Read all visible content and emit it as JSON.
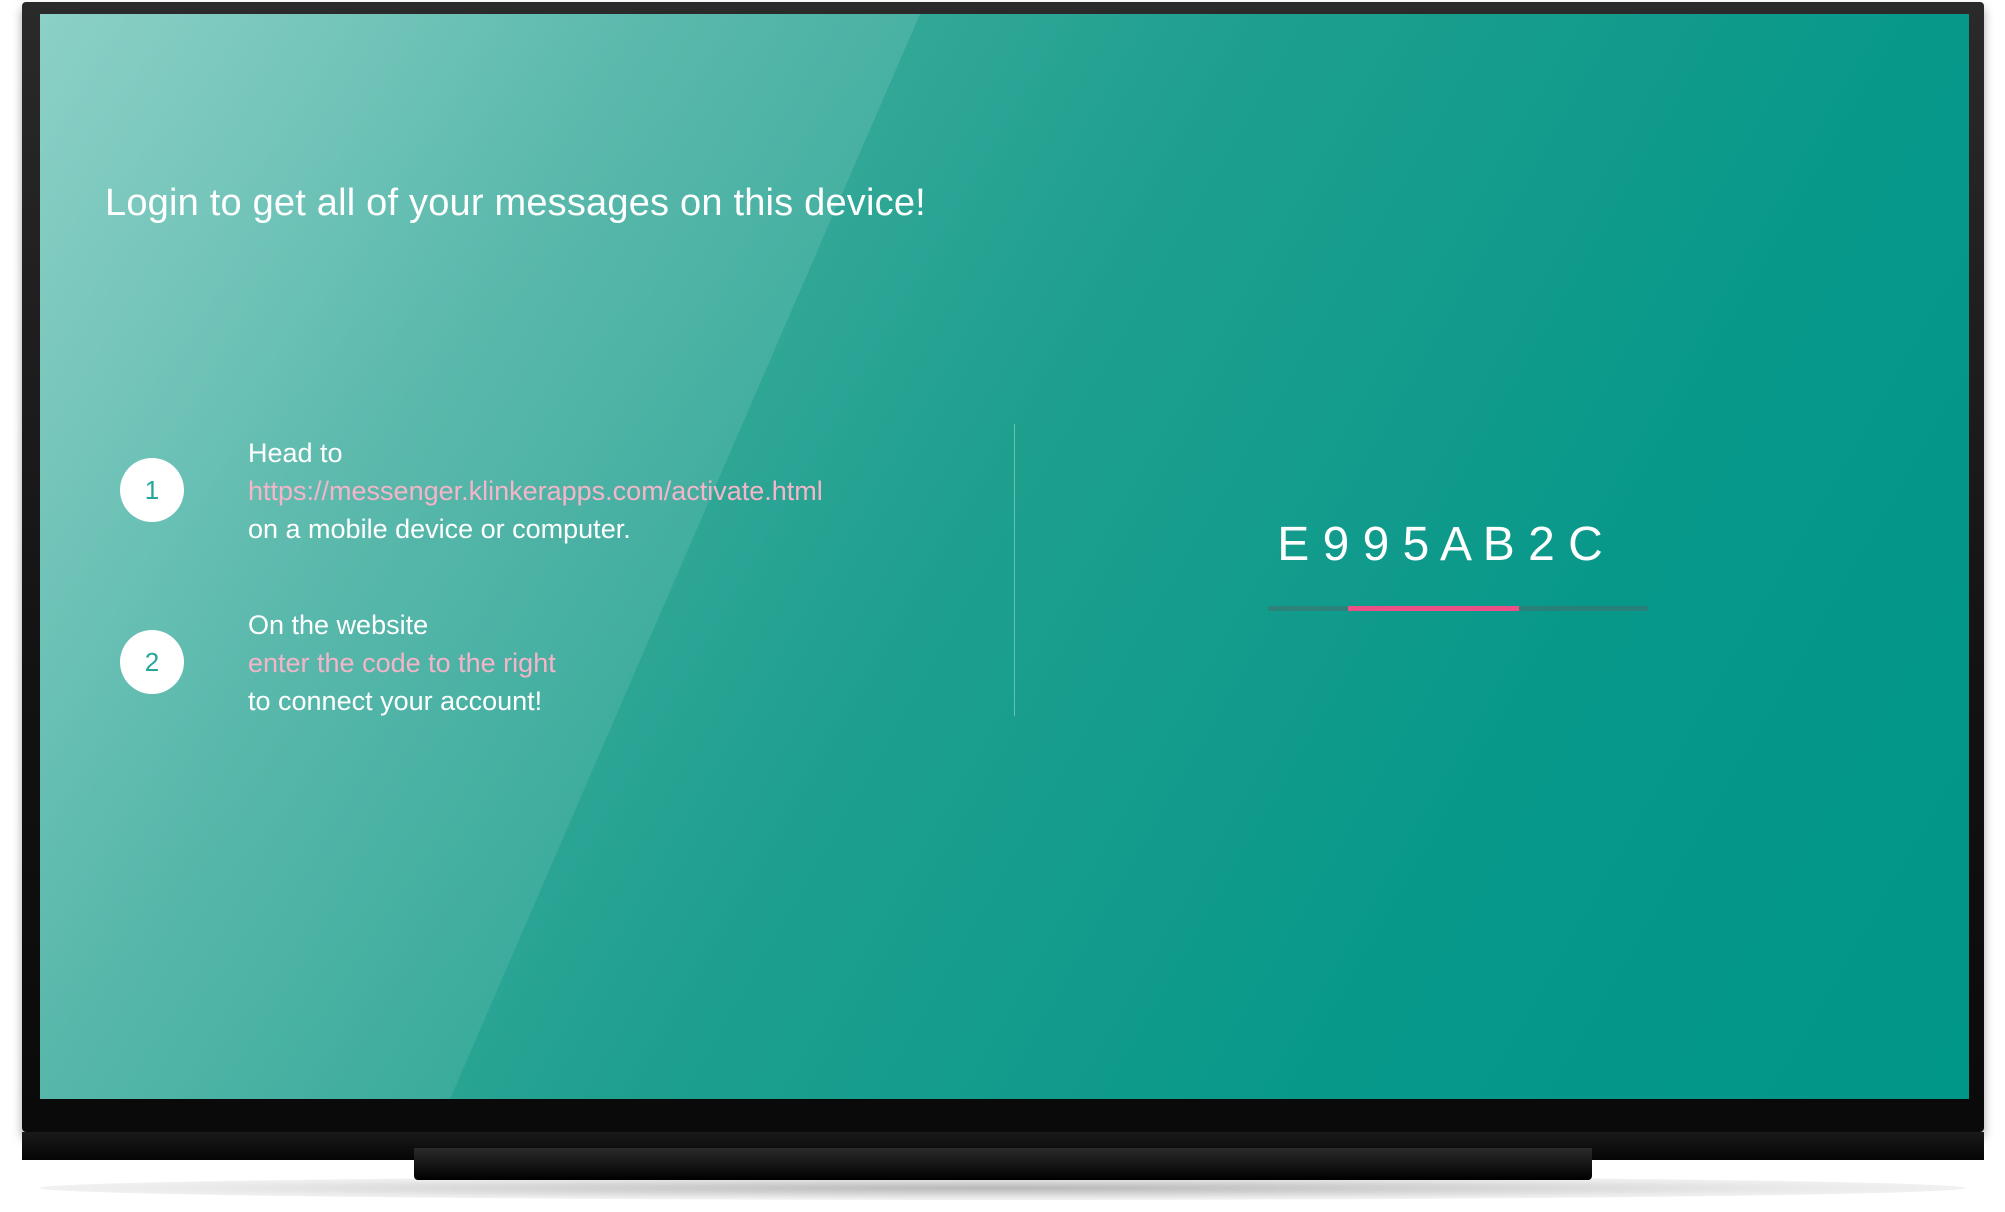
{
  "screen": {
    "title": "Login to get all of your messages on this device!",
    "steps": [
      {
        "number": "1",
        "line1": "Head to",
        "link": "https://messenger.klinkerapps.com/activate.html",
        "line3": "on a mobile device or computer."
      },
      {
        "number": "2",
        "line1": "On the website",
        "highlight": "enter the code to the right",
        "line3": "to connect your account!"
      }
    ],
    "activation_code": "E 9 9 5 A B 2 C",
    "progress": {
      "start_fraction": 0.21,
      "end_fraction": 0.66
    }
  },
  "colors": {
    "background_start": "#73c6bb",
    "background_end": "#009688",
    "accent_pink": "#ef4f87",
    "link_pink": "#f5b5c8",
    "circle_text": "#26a69a"
  },
  "icons": {
    "tv": "television-frame"
  }
}
